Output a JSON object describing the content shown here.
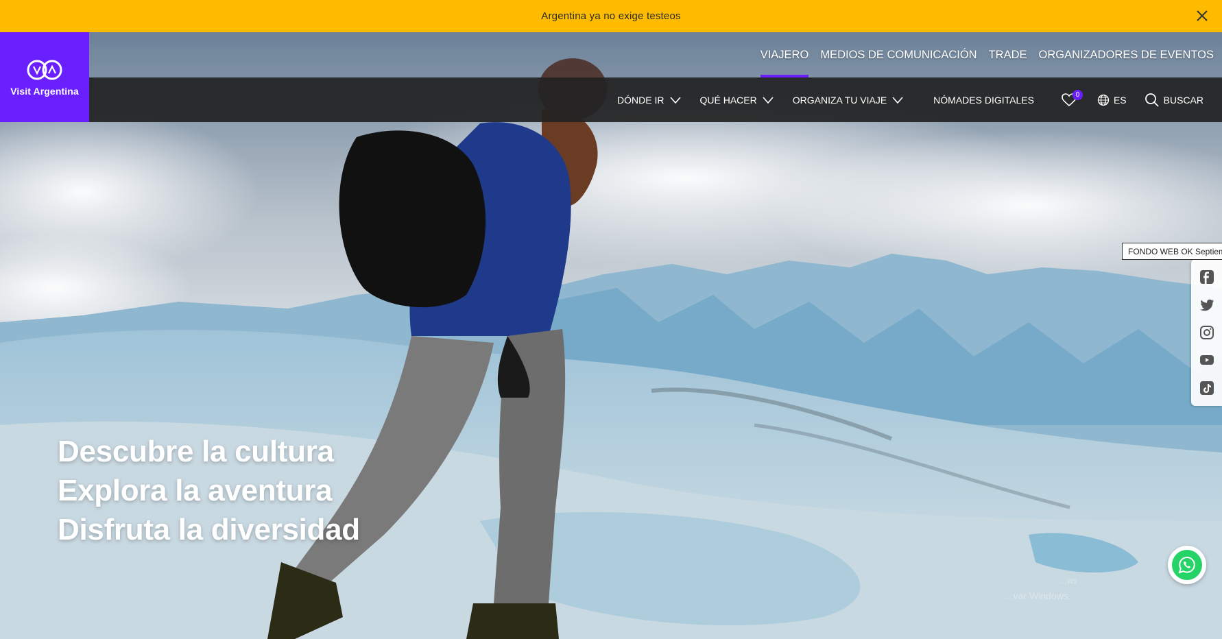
{
  "alert": {
    "text": "Argentina ya no exige testeos"
  },
  "logo": {
    "text": "Visit Argentina"
  },
  "top_nav": [
    {
      "label": "VIAJERO",
      "active": true
    },
    {
      "label": "MEDIOS DE COMUNICACIÓN",
      "active": false
    },
    {
      "label": "TRADE",
      "active": false
    },
    {
      "label": "ORGANIZADORES DE EVENTOS",
      "active": false
    }
  ],
  "main_nav": {
    "donde_ir": "DÓNDE IR",
    "que_hacer": "QUÉ HACER",
    "organiza": "ORGANIZA TU VIAJE",
    "nomades": "NÓMADES DIGITALES",
    "favorites_count": "0",
    "language": "ES",
    "search": "BUSCAR"
  },
  "hero": {
    "line1": "Descubre la cultura",
    "line2": "Explora la aventura",
    "line3": "Disfruta la diversidad"
  },
  "tooltip": "FONDO WEB OK Septiembre",
  "social": [
    "facebook-icon",
    "twitter-icon",
    "instagram-icon",
    "youtube-icon",
    "tiktok-icon"
  ],
  "watermark": {
    "line1": "...ws",
    "line2": "...var Windows."
  },
  "colors": {
    "brand_purple": "#6a1fff",
    "alert_yellow": "#ffbb00",
    "nav_dark": "#222222",
    "whatsapp": "#25d366"
  }
}
